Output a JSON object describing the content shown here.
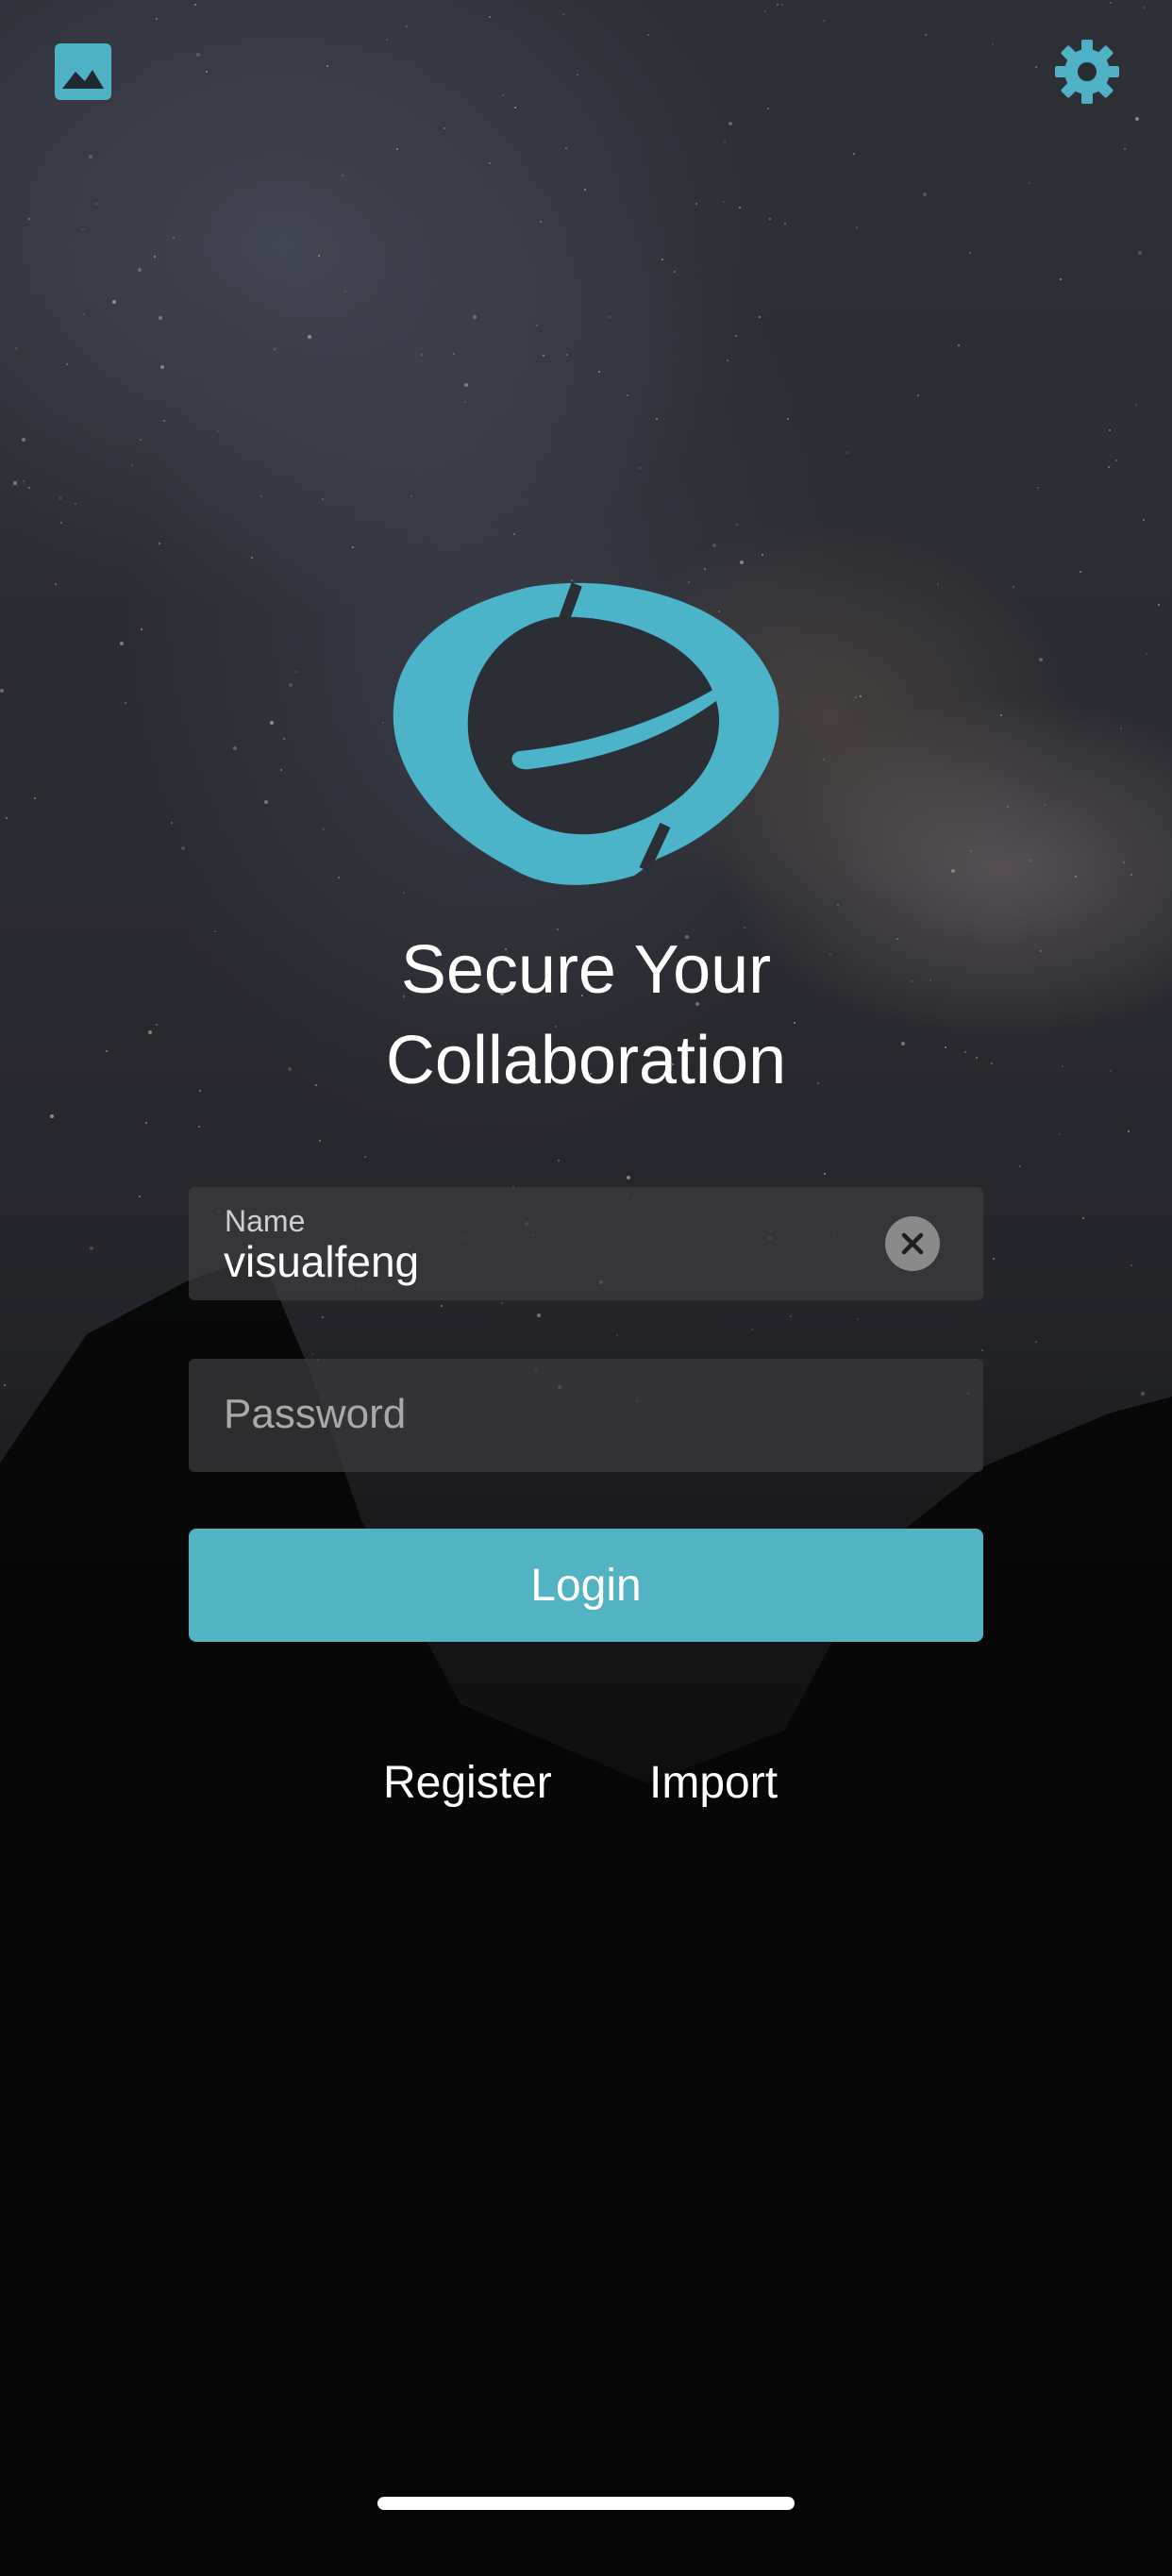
{
  "colors": {
    "accent": "#52b3c3",
    "icon": "#4fb2c4",
    "field_bg": "#3c3c40",
    "text": "#ffffff",
    "placeholder": "#a9a9a9"
  },
  "toolbar": {
    "left_icon": "image-icon",
    "right_icon": "gear-icon"
  },
  "logo": {
    "icon": "app-logo"
  },
  "hero": {
    "title_line1": "Secure Your",
    "title_line2": "Collaboration"
  },
  "form": {
    "name_label": "Name",
    "name_value": "visualfeng",
    "clear_icon": "close-icon",
    "password_placeholder": "Password",
    "login_label": "Login"
  },
  "links": {
    "register": "Register",
    "import": "Import"
  }
}
